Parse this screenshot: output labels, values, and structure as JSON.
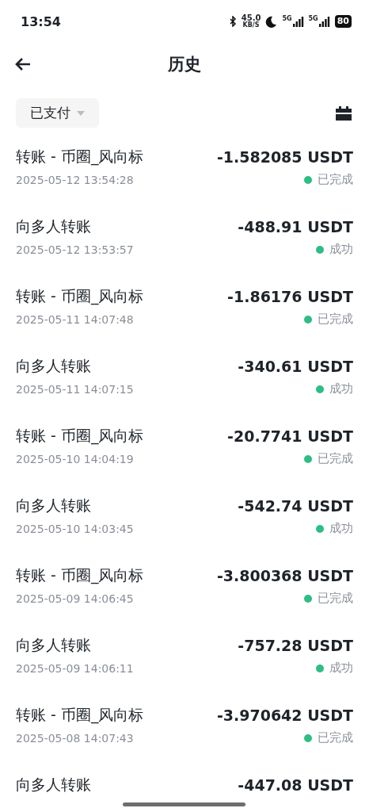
{
  "status_bar": {
    "time": "13:54",
    "speed_value": "45.0",
    "speed_unit": "KB/S",
    "network_1": "5G",
    "network_2": "5G",
    "battery": "80"
  },
  "header": {
    "title": "历史"
  },
  "filter": {
    "label": "已支付"
  },
  "transactions": [
    {
      "title": "转账 - 币圈_风向标",
      "amount": "-1.582085 USDT",
      "date": "2025-05-12 13:54:28",
      "status": "已完成"
    },
    {
      "title": "向多人转账",
      "amount": "-488.91 USDT",
      "date": "2025-05-12 13:53:57",
      "status": "成功"
    },
    {
      "title": "转账 - 币圈_风向标",
      "amount": "-1.86176 USDT",
      "date": "2025-05-11 14:07:48",
      "status": "已完成"
    },
    {
      "title": "向多人转账",
      "amount": "-340.61 USDT",
      "date": "2025-05-11 14:07:15",
      "status": "成功"
    },
    {
      "title": "转账 - 币圈_风向标",
      "amount": "-20.7741 USDT",
      "date": "2025-05-10 14:04:19",
      "status": "已完成"
    },
    {
      "title": "向多人转账",
      "amount": "-542.74 USDT",
      "date": "2025-05-10 14:03:45",
      "status": "成功"
    },
    {
      "title": "转账 - 币圈_风向标",
      "amount": "-3.800368 USDT",
      "date": "2025-05-09 14:06:45",
      "status": "已完成"
    },
    {
      "title": "向多人转账",
      "amount": "-757.28 USDT",
      "date": "2025-05-09 14:06:11",
      "status": "成功"
    },
    {
      "title": "转账 - 币圈_风向标",
      "amount": "-3.970642 USDT",
      "date": "2025-05-08 14:07:43",
      "status": "已完成"
    },
    {
      "title": "向多人转账",
      "amount": "-447.08 USDT"
    }
  ]
}
